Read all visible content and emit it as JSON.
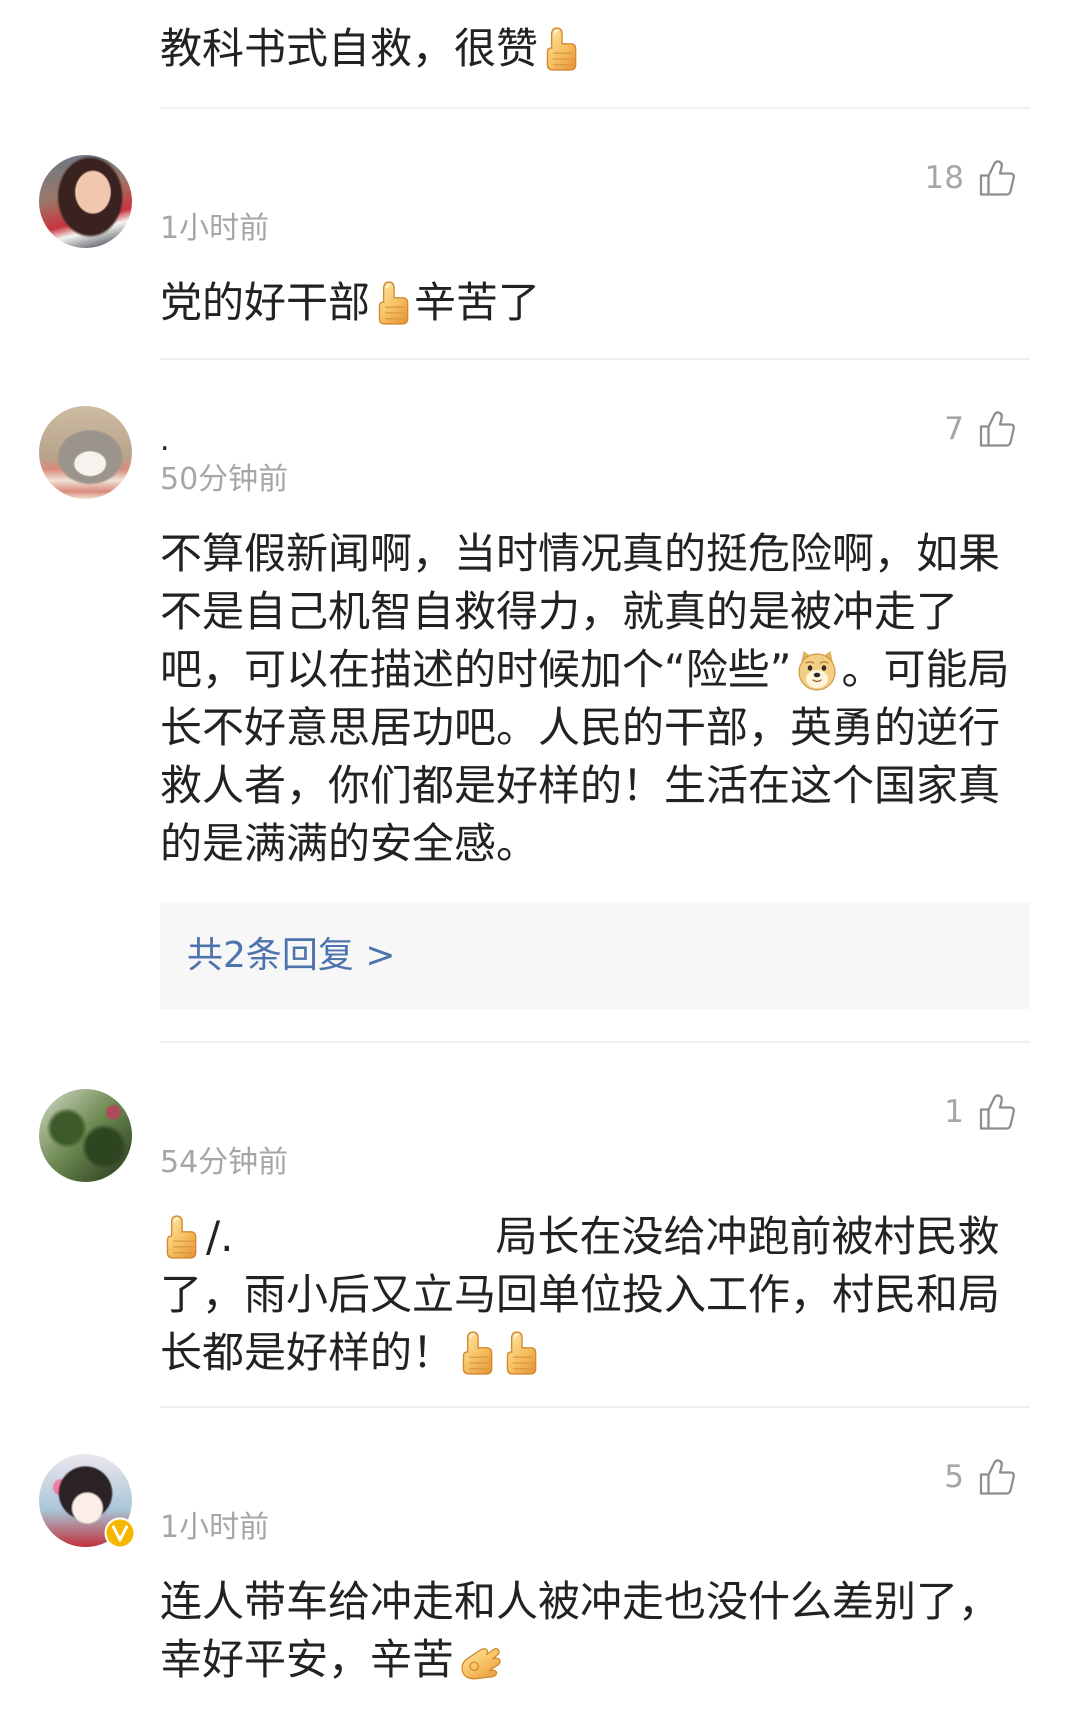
{
  "colors": {
    "text": "#222222",
    "meta": "#a6a6a6",
    "link": "#4d74ad",
    "reply_bg": "#f7f7f7",
    "divider": "#f0f0f0",
    "verified": "#f5b800"
  },
  "icons": {
    "like": "like-thumb-outline-icon",
    "verified": "verified-v-badge-icon"
  },
  "comments": [
    {
      "lines": [
        [
          {
            "text": "教科书式自救，很赞"
          },
          {
            "emoji": "thumbs-up-emoji"
          }
        ]
      ]
    },
    {
      "time": "1小时前",
      "likes": "18",
      "lines": [
        [
          {
            "text": "党的好干部"
          },
          {
            "emoji": "thumbs-up-emoji"
          },
          {
            "text": "辛苦了"
          }
        ]
      ]
    },
    {
      "name": ".",
      "time": "50分钟前",
      "likes": "7",
      "lines": [
        [
          {
            "text": "不算假新闻啊，当时情况真的挺危险啊，如果"
          }
        ],
        [
          {
            "text": "不是自己机智自救得力，就真的是被冲走了"
          }
        ],
        [
          {
            "text": "吧，可以在描述的时候加个“险些”"
          },
          {
            "emoji": "doge-emoji"
          },
          {
            "text": "。可能局"
          }
        ],
        [
          {
            "text": "长不好意思居功吧。人民的干部，英勇的逆行"
          }
        ],
        [
          {
            "text": "救人者，你们都是好样的！生活在这个国家真"
          }
        ],
        [
          {
            "text": "的是满满的安全感。"
          }
        ]
      ],
      "replies_label": "共2条回复 >"
    },
    {
      "time": "54分钟前",
      "likes": "1",
      "lines": [
        [
          {
            "emoji": "thumbs-up-emoji"
          },
          {
            "text": "/."
          },
          {
            "text": "局长在没给冲跑前被村民救"
          }
        ],
        [
          {
            "text": "了，雨小后又立马回单位投入工作，村民和局"
          }
        ],
        [
          {
            "text": "长都是好样的！"
          },
          {
            "emoji": "thumbs-up-emoji"
          },
          {
            "emoji": "thumbs-up-emoji"
          }
        ]
      ]
    },
    {
      "verified": true,
      "time": "1小时前",
      "likes": "5",
      "lines": [
        [
          {
            "text": "连人带车给冲走和人被冲走也没什么差别了，"
          }
        ],
        [
          {
            "text": "幸好平安，辛苦"
          },
          {
            "emoji": "ok-hand-emoji"
          }
        ]
      ]
    }
  ]
}
